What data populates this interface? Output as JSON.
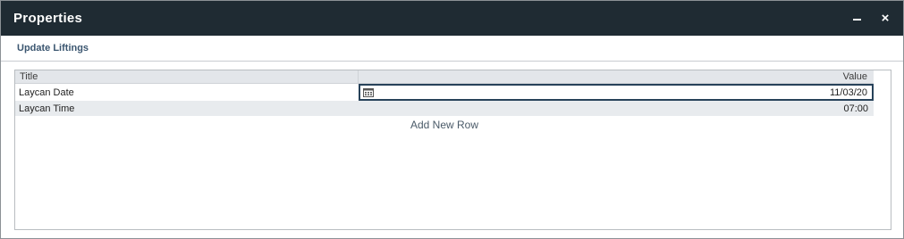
{
  "window": {
    "title": "Properties",
    "minimize_label": "minimize",
    "close_label": "×"
  },
  "toolbar": {
    "update_liftings_label": "Update Liftings"
  },
  "grid": {
    "columns": {
      "title": "Title",
      "value": "Value"
    },
    "rows": [
      {
        "title": "Laycan Date",
        "value": "11/03/20",
        "editing": true
      },
      {
        "title": "Laycan Time",
        "value": "07:00",
        "editing": false
      }
    ],
    "add_row_label": "Add New Row"
  },
  "colors": {
    "titlebar": "#1f2b33",
    "accent_link": "#3b5670",
    "editor_border": "#27425a",
    "alt_row": "#e8ebee"
  },
  "icons": {
    "minimize": "minimize-icon",
    "close": "close-icon",
    "calendar": "calendar-icon"
  }
}
